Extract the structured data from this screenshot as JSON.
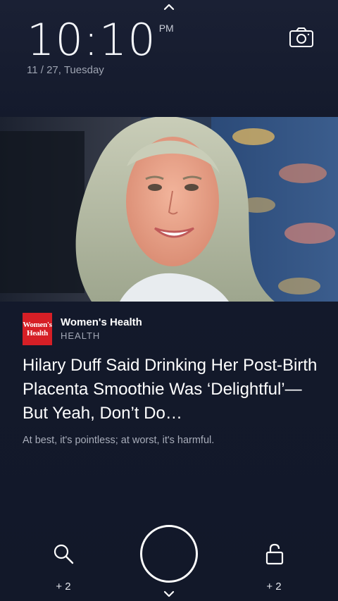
{
  "status": {
    "time": "10:10",
    "ampm": "PM",
    "date": "11 / 27, Tuesday"
  },
  "icons": {
    "top": "chevron-up-icon",
    "camera": "camera-icon",
    "search": "search-icon",
    "lock": "lock-icon",
    "bottom": "chevron-down-icon"
  },
  "article": {
    "logo_line1": "Women's",
    "logo_line2": "Health",
    "source": "Women's Health",
    "category": "HEALTH",
    "headline": "Hilary Duff Said Drinking Her Post-Birth Placenta Smoothie Was ‘Delightful’—But Yeah, Don’t Do…",
    "summary": "At best, it's pointless; at worst, it's harmful."
  },
  "bottom": {
    "left_count": "+ 2",
    "right_count": "+ 2"
  },
  "colors": {
    "background": "#141a2c",
    "logo_red": "#d61f26"
  }
}
